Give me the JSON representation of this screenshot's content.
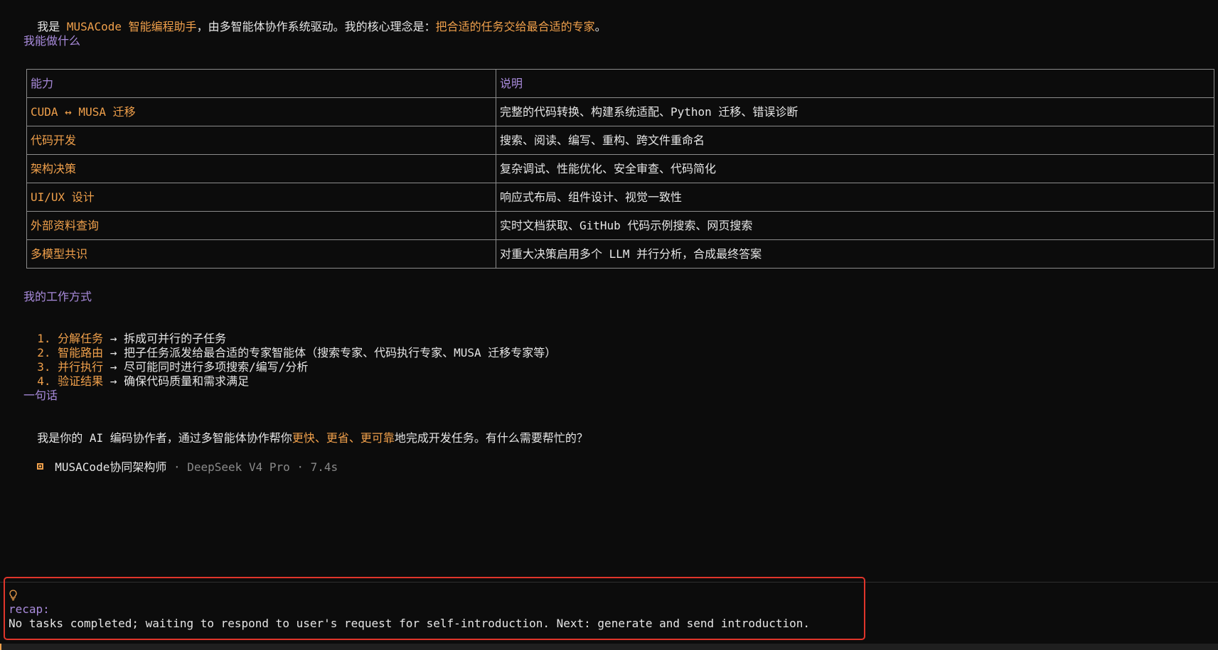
{
  "intro": {
    "prefix": "我是 ",
    "name": "MUSACode 智能编程助手",
    "middle": "，由多智能体协作系统驱动。我的核心理念是：",
    "principle": "把合适的任务交给最合适的专家",
    "suffix": "。"
  },
  "section_capabilities": "我能做什么",
  "capability_table": {
    "headers": [
      "能力",
      "说明"
    ],
    "rows": [
      {
        "name": "CUDA ↔ MUSA 迁移",
        "desc": "完整的代码转换、构建系统适配、Python 迁移、错误诊断"
      },
      {
        "name": "代码开发",
        "desc": "搜索、阅读、编写、重构、跨文件重命名"
      },
      {
        "name": "架构决策",
        "desc": "复杂调试、性能优化、安全审查、代码简化"
      },
      {
        "name": "UI/UX 设计",
        "desc": "响应式布局、组件设计、视觉一致性"
      },
      {
        "name": "外部资料查询",
        "desc": "实时文档获取、GitHub 代码示例搜索、网页搜索"
      },
      {
        "name": "多模型共识",
        "desc": "对重大决策启用多个 LLM 并行分析，合成最终答案"
      }
    ]
  },
  "section_workflow": "我的工作方式",
  "workflow": [
    {
      "num": "1.",
      "title": "分解任务",
      "arrow": " → ",
      "desc": "拆成可并行的子任务"
    },
    {
      "num": "2.",
      "title": "智能路由",
      "arrow": " → ",
      "desc": "把子任务派发给最合适的专家智能体（搜索专家、代码执行专家、MUSA 迁移专家等）"
    },
    {
      "num": "3.",
      "title": "并行执行",
      "arrow": " → ",
      "desc": "尽可能同时进行多项搜索/编写/分析"
    },
    {
      "num": "4.",
      "title": "验证结果",
      "arrow": " → ",
      "desc": "确保代码质量和需求满足"
    }
  ],
  "section_summary": "一句话",
  "summary": {
    "prefix": "我是你的 AI 编码协作者，通过多智能体协作帮你",
    "h1": "更快",
    "sep1": "、",
    "h2": "更省",
    "sep2": "、",
    "h3": "更可靠",
    "suffix": "地完成开发任务。有什么需要帮忙的？"
  },
  "signature": {
    "agent": "MUSACode协同架构师",
    "meta": " · DeepSeek V4 Pro · 7.4s"
  },
  "recap": {
    "icon": "lightbulb-icon",
    "label": "recap:",
    "text": "No tasks completed; waiting to respond to user's request for self-introduction. Next: generate and send introduction."
  },
  "colors": {
    "accent": "#f0a04b",
    "heading": "#a98bdc",
    "highlight_border": "#e0352b",
    "background": "#0c0c0c"
  }
}
